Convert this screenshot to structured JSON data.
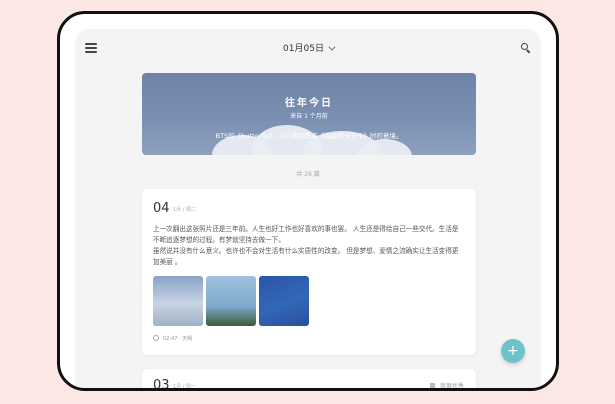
{
  "header": {
    "date": "01月05日",
    "menu_icon": "menu-icon",
    "search_icon": "search-icon"
  },
  "banner": {
    "title": "往年今日",
    "subtitle": "来自 1 个月前",
    "text": "BTS的《butterfly》，以让我回想着《海边的卡夫卡》时的意境。"
  },
  "count_label": "共 28 篇",
  "entries": [
    {
      "day": "04",
      "meta": "1月 / 周二",
      "paragraphs": [
        "上一次翻出这张照片还是三年前。人生也好工作也好喜欢的事也罢。 人生还是得给自己一些交代。生活是不断追逐梦想的过程。有梦就坚持去做一下。",
        "虽然说并没有什么意义。也许也不会对生活有什么实质性的改变。 但是梦想、爱情之流确实让生活变得更加美丽 。"
      ],
      "footer": "02:47 · 天晴"
    },
    {
      "day": "03",
      "meta": "1月 / 周一",
      "tag": "我很优秀"
    }
  ],
  "fab_label": "+",
  "colors": {
    "background": "#fbe8e5",
    "accent": "#6ec2c9",
    "banner": "#7b8fb2"
  }
}
